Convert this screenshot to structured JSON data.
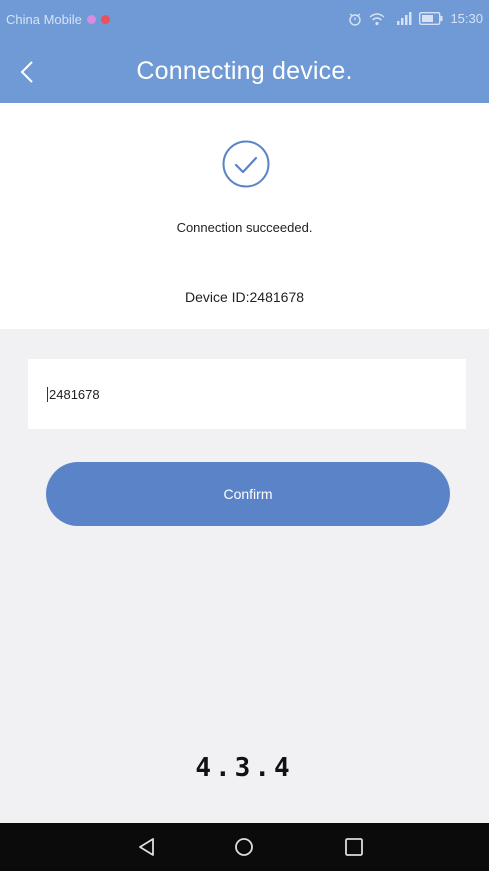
{
  "status_bar": {
    "carrier": "China Mobile",
    "time": "15:30",
    "icons": [
      "sim-notification-icon",
      "message-notification-icon",
      "alarm-icon",
      "wifi-icon",
      "cellular-signal-icon",
      "battery-icon"
    ],
    "colors": {
      "sim_dot": "#d88ce0",
      "message_dot": "#e8505b"
    }
  },
  "header": {
    "title": "Connecting device.",
    "back_icon": "chevron-left-icon"
  },
  "status": {
    "icon": "check-circle-icon",
    "message": "Connection succeeded.",
    "device_id_label": "Device ID:2481678"
  },
  "form": {
    "device_id_value": "2481678",
    "confirm_label": "Confirm"
  },
  "caption": {
    "label": "4.3.4"
  },
  "nav_bar": {
    "buttons": [
      "back-triangle-icon",
      "home-circle-icon",
      "recents-square-icon"
    ]
  },
  "colors": {
    "accent": "#6f9ad6",
    "button": "#5b84c8",
    "background": "#f1f0f2"
  }
}
